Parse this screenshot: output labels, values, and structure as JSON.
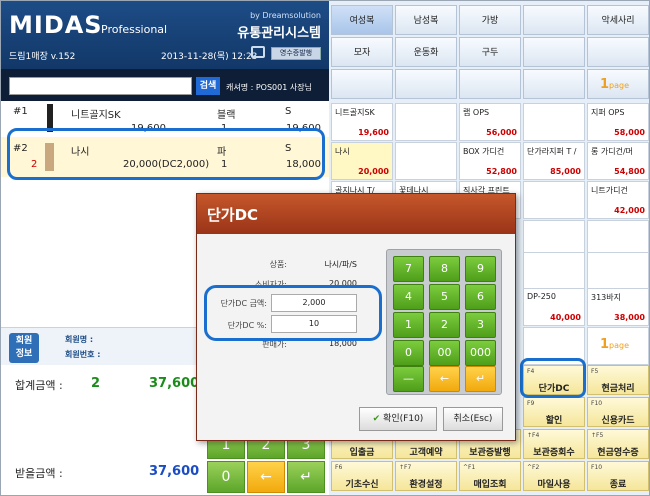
{
  "header": {
    "logo": "MIDAS",
    "logo_sub": "Professional",
    "maker": "by Dreamsolution",
    "system_title": "유통관리시스템",
    "store": "드림1매장 v.152",
    "datetime": "2013-11-28(목) 12:23",
    "receipt_button": "영수증발행"
  },
  "search": {
    "button": "검색",
    "cashier": "캐셔명 : POS001 사장님"
  },
  "items": [
    {
      "no": "#1",
      "name": "니트골지SK",
      "color": "블랙",
      "size": "S",
      "sub": "",
      "price": "19,600",
      "qty": "1",
      "amount": "19,600"
    },
    {
      "no": "#2",
      "name": "나시",
      "color": "파",
      "size": "S",
      "sub": "2",
      "price": "20,000(DC2,000)",
      "qty": "1",
      "amount": "18,000"
    }
  ],
  "member": {
    "badge": "회원\n정보",
    "name_label": "회원명 :",
    "no_label": "회원번호 :"
  },
  "totals": {
    "total_label": "합계금액 :",
    "total_qty": "2",
    "total_amount": "37,600",
    "received_label": "받을금액 :",
    "received_amount": "37,600"
  },
  "left_keypad": {
    "k1": "1",
    "k2": "2",
    "k3": "3",
    "k0": "0",
    "left": "←",
    "enter": "↵"
  },
  "categories": [
    [
      "여성복",
      "남성복",
      "가방",
      "",
      "악세사리"
    ],
    [
      "모자",
      "운동화",
      "구두",
      "",
      ""
    ]
  ],
  "page_top": {
    "num": "1",
    "label": "page"
  },
  "page_bottom": {
    "num": "1",
    "label": "page"
  },
  "products": [
    {
      "name": "니트골지SK",
      "price": "19,600"
    },
    {
      "name": "랩 OPS",
      "price": "56,000"
    },
    {
      "name": "지퍼 OPS",
      "price": "58,000"
    },
    {
      "name": "나시",
      "price": "20,000"
    },
    {
      "name": "BOX 가디건",
      "price": "52,800"
    },
    {
      "name": "단가라지퍼 T /",
      "price": "85,000"
    },
    {
      "name": "롱 가디건/머",
      "price": "54,800"
    },
    {
      "name": "골지나시 T/",
      "price": ""
    },
    {
      "name": "꽃데나시",
      "price": ""
    },
    {
      "name": "직사각 프린트",
      "price": ""
    },
    {
      "name": "니트가디건",
      "price": "42,000"
    },
    {
      "name": "DP-250",
      "price": "40,000"
    },
    {
      "name": "313바지",
      "price": "38,000"
    }
  ],
  "fkeys": [
    {
      "key": "F4",
      "label": "단가DC"
    },
    {
      "key": "F5",
      "label": "현금처리"
    },
    {
      "key": "F9",
      "label": "할인"
    },
    {
      "key": "F10",
      "label": "신용카드"
    },
    {
      "key": "",
      "label": "입출금"
    },
    {
      "key": "",
      "label": "고객예약"
    },
    {
      "key": "",
      "label": "보관증발행"
    },
    {
      "key": "↑F4",
      "label": "보관증회수"
    },
    {
      "key": "↑F5",
      "label": "현금영수증"
    },
    {
      "key": "F6",
      "label": "기초수신"
    },
    {
      "key": "↑F7",
      "label": "환경설정"
    },
    {
      "key": "^F1",
      "label": "매입조회"
    },
    {
      "key": "^F2",
      "label": "마일사용"
    },
    {
      "key": "F10",
      "label": "종료"
    }
  ],
  "dialog": {
    "title": "단가DC",
    "product_label": "상품:",
    "product_value": "나시/파/S",
    "consumer_label": "소비자가:",
    "consumer_value": "20,000",
    "dc_amount_label": "단가DC 금액:",
    "dc_amount_value": "2,000",
    "dc_pct_label": "단가DC %:",
    "dc_pct_value": "10",
    "sale_label": "판매가:",
    "sale_value": "18,000",
    "confirm": "확인(F10)",
    "cancel": "취소(Esc)",
    "keys": [
      "7",
      "8",
      "9",
      "4",
      "5",
      "6",
      "1",
      "2",
      "3",
      "0",
      "00",
      "000",
      "—",
      "←",
      "↵"
    ]
  }
}
